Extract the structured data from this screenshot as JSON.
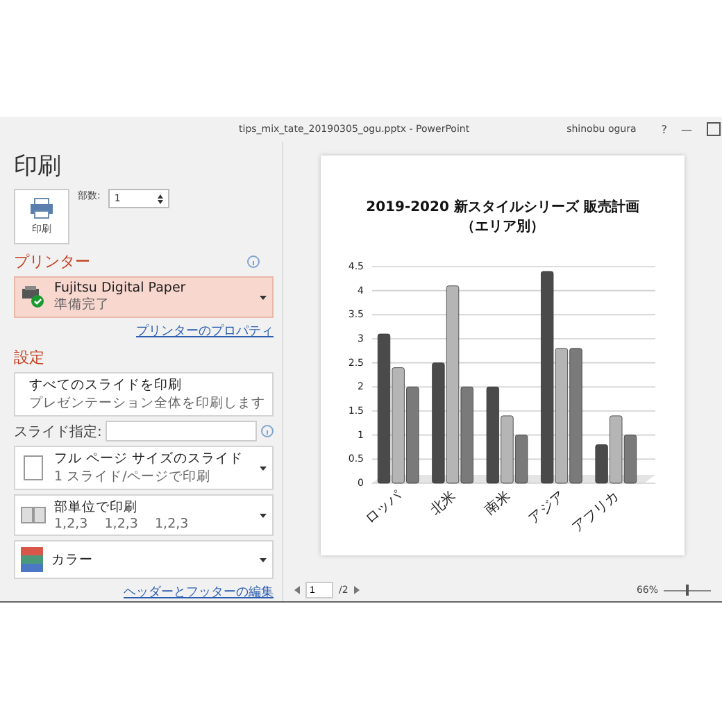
{
  "window": {
    "title": "tips_mix_tate_20190305_ogu.pptx  -  PowerPoint",
    "user": "shinobu ogura",
    "help": "?",
    "minimize": "—"
  },
  "print": {
    "heading": "印刷",
    "button_label": "印刷",
    "copies_label": "部数:",
    "copies": "1"
  },
  "printer": {
    "heading": "プリンター",
    "name": "Fujitsu Digital Paper",
    "status": "準備完了",
    "properties_link": "プリンターのプロパティ"
  },
  "settings": {
    "heading": "設定",
    "options": [
      {
        "kind": "slides",
        "title": "すべてのスライドを印刷",
        "subtitle": "プレゼンテーション全体を印刷します"
      },
      {
        "kind": "field",
        "label": "スライド指定:"
      },
      {
        "kind": "page",
        "title": "フル ページ サイズのスライド",
        "subtitle": "1 スライド/ページで印刷"
      },
      {
        "kind": "collate",
        "title": "部単位で印刷",
        "subtitle": "1,2,3    1,2,3    1,2,3"
      },
      {
        "kind": "color",
        "title": "カラー"
      }
    ],
    "footer_link": "ヘッダーとフッターの編集"
  },
  "preview": {
    "page": "1",
    "page_total": "/2",
    "zoom": "66%",
    "zoom_slider": {
      "level": 0.5
    },
    "chart_data": {
      "type": "bar",
      "title": "2019-2020 新スタイルシリーズ  販売計画",
      "subtitle": "（エリア別）",
      "categories": [
        "ロッパ",
        "北米",
        "南米",
        "アジア",
        "アフリカ"
      ],
      "series": [
        {
          "color": "#4a4a4a",
          "values": [
            3.1,
            2.5,
            2.0,
            4.4,
            0.8
          ]
        },
        {
          "color": "#b5b5b5",
          "values": [
            2.4,
            4.1,
            1.4,
            2.8,
            1.4
          ]
        },
        {
          "color": "#7a7a7a",
          "values": [
            2.0,
            2.0,
            1.0,
            2.8,
            1.0
          ]
        }
      ],
      "ylim": [
        0,
        4.5
      ],
      "grid": true,
      "yticks": [
        0,
        0.5,
        1,
        1.5,
        2,
        2.5,
        3,
        3.5,
        4,
        4.5
      ]
    }
  }
}
